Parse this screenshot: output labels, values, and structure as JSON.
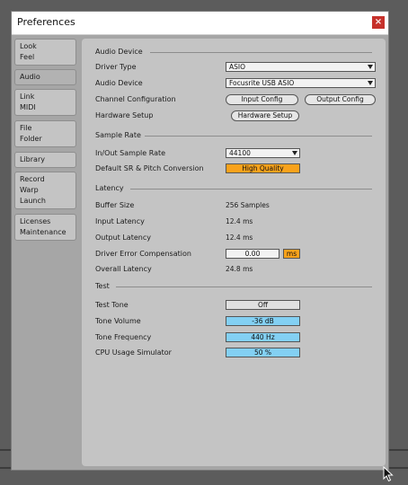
{
  "window": {
    "title": "Preferences",
    "close_glyph": "×"
  },
  "colors": {
    "accent_orange": "#f9a21b",
    "value_blue": "#83d0f3",
    "close_red": "#c6312b"
  },
  "sidebar": {
    "tabs": [
      {
        "lines": [
          "Look",
          "Feel"
        ]
      },
      {
        "lines": [
          "Audio"
        ]
      },
      {
        "lines": [
          "Link",
          "MIDI"
        ]
      },
      {
        "lines": [
          "File",
          "Folder"
        ]
      },
      {
        "lines": [
          "Library"
        ]
      },
      {
        "lines": [
          "Record",
          "Warp",
          "Launch"
        ]
      },
      {
        "lines": [
          "Licenses",
          "Maintenance"
        ]
      }
    ],
    "active": "Audio"
  },
  "audio_device": {
    "header": "Audio Device",
    "driver_type_label": "Driver Type",
    "driver_type_value": "ASIO",
    "device_label": "Audio Device",
    "device_value": "Focusrite USB ASIO",
    "channel_label": "Channel Configuration",
    "input_config": "Input Config",
    "output_config": "Output Config",
    "hardware_label": "Hardware Setup",
    "hardware_button": "Hardware Setup"
  },
  "sample_rate": {
    "header": "Sample Rate",
    "rate_label": "In/Out Sample Rate",
    "rate_value": "44100",
    "conversion_label": "Default SR & Pitch Conversion",
    "conversion_value": "High Quality"
  },
  "latency": {
    "header": "Latency",
    "buffer_label": "Buffer Size",
    "buffer_value": "256 Samples",
    "input_label": "Input Latency",
    "input_value": "12.4 ms",
    "output_label": "Output Latency",
    "output_value": "12.4 ms",
    "comp_label": "Driver Error Compensation",
    "comp_value": "0.00",
    "comp_unit": "ms",
    "overall_label": "Overall Latency",
    "overall_value": "24.8 ms"
  },
  "test": {
    "header": "Test",
    "tone_label": "Test Tone",
    "tone_value": "Off",
    "volume_label": "Tone Volume",
    "volume_value": "-36 dB",
    "freq_label": "Tone Frequency",
    "freq_value": "440 Hz",
    "cpu_label": "CPU Usage Simulator",
    "cpu_value": "50 %"
  }
}
